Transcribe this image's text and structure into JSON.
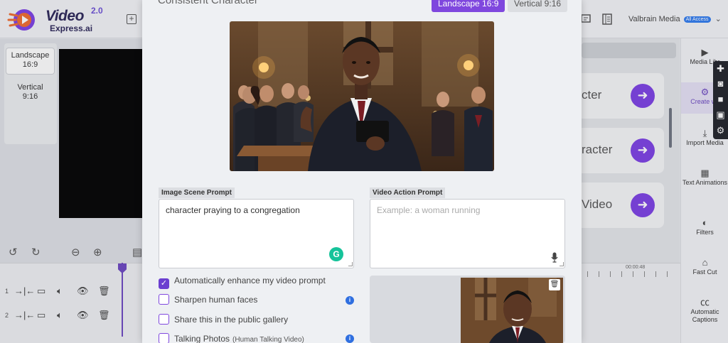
{
  "app": {
    "logo_word": "Video",
    "logo_sub": "Express.ai",
    "logo_version": "2.0",
    "account_name": "Valbrain Media",
    "account_badge": "All Access"
  },
  "left_panel": {
    "ratios": [
      {
        "label": "Landscape\n16:9",
        "active": true
      },
      {
        "label": "Vertical\n9:16",
        "active": false
      }
    ]
  },
  "cards": [
    {
      "label": "cter"
    },
    {
      "label": "racter"
    },
    {
      "label": "Video"
    }
  ],
  "sidebar": {
    "items": [
      {
        "label": "Media Libr",
        "icon": "media-library-icon"
      },
      {
        "label": "Create wit",
        "icon": "robot-icon"
      },
      {
        "label": "Import Media",
        "icon": "import-icon"
      },
      {
        "label": "Text Animations",
        "icon": "film-icon"
      },
      {
        "label": "Filters",
        "icon": "filters-icon"
      },
      {
        "label": "Fast Cut",
        "icon": "fast-cut-icon"
      },
      {
        "label": "Automatic Captions",
        "icon": "captions-icon"
      }
    ]
  },
  "timeline": {
    "time_label": "00:00:48",
    "tracks": [
      "1",
      "2"
    ]
  },
  "modal": {
    "title": "Consistent Character",
    "ratio_landscape": "Landscape 16:9",
    "ratio_vertical": "Vertical 9:16",
    "image_prompt_label": "Image Scene Prompt",
    "image_prompt_value": "character praying to a congregation",
    "video_prompt_label": "Video Action Prompt",
    "video_prompt_placeholder": "Example: a woman running",
    "options": [
      {
        "label": "Automatically enhance my video prompt",
        "checked": true,
        "info": false,
        "sub": ""
      },
      {
        "label": "Sharpen human faces",
        "checked": false,
        "info": true,
        "sub": ""
      },
      {
        "label": "Share this in the public gallery",
        "checked": false,
        "info": false,
        "sub": ""
      },
      {
        "label": "Talking Photos",
        "checked": false,
        "info": true,
        "sub": "(Human Talking Video)"
      }
    ]
  },
  "colors": {
    "accent": "#7f47de",
    "grammarly": "#15c39a",
    "info": "#2f6fe0"
  }
}
